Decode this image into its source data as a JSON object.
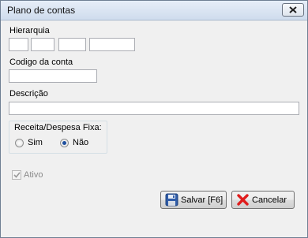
{
  "window": {
    "title": "Plano de contas",
    "close_icon": "close-icon"
  },
  "form": {
    "hierarchy_label": "Hierarquia",
    "hierarchy_fields": [
      "",
      "",
      "",
      ""
    ],
    "account_code_label": "Codigo da conta",
    "account_code_value": "",
    "description_label": "Descrição",
    "description_value": "",
    "fixed_group": {
      "title": "Receita/Despesa Fixa:",
      "options": [
        {
          "label": "Sim",
          "selected": false
        },
        {
          "label": "Não",
          "selected": true
        }
      ]
    },
    "active_checkbox": {
      "label": "Ativo",
      "checked": true,
      "enabled": false
    }
  },
  "buttons": {
    "save_label": "Salvar [F6]",
    "save_icon": "floppy-disk-icon",
    "cancel_label": "Cancelar",
    "cancel_icon": "red-x-icon"
  },
  "colors": {
    "accent": "#1e4f9e",
    "cancel_red": "#e01c1c"
  }
}
